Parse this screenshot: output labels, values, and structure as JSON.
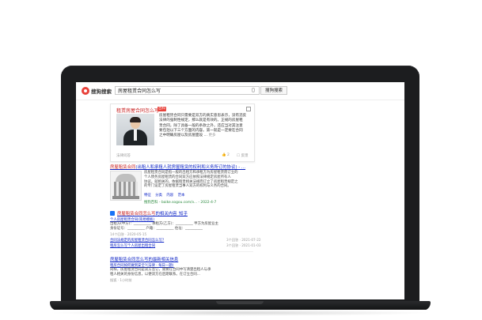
{
  "header": {
    "logo": "搜狗搜索",
    "query": "房屋租赁合同怎么写",
    "search_button": "搜狗搜索"
  },
  "answer_card": {
    "title": "租赁房屋合同怎么写",
    "badge": "百科",
    "lines": [
      "房屋租赁合同只需要是双方的真实意思表示，没有违反",
      "法律的强制性规定，那么就是有效的。正规的房屋租",
      "赁合同，除了具备一般的条款之外，还应当对其注意",
      "要包括以下三个方面的内容。第一就是一定要在合同",
      "之中明确房屋以及房屋面设 ... "
    ],
    "more": "更多",
    "source": "法律问答",
    "likes": "2",
    "feedback": "反馈"
  },
  "results": [
    {
      "title_pre": "房屋租赁合同",
      "title_rest": "(出租人和承租人就房屋租赁的权利和义务所订的协议) - ...",
      "lines": [
        "房屋租赁合同是指一般的出租方和承租方为房屋租赁而订立的",
        "个人债务房屋租赁的合同双方应依照法律规定房屋所有人",
        "协议。就相关的，依据租赁相关法规而订立了房屋租赁规定之",
        "的专门设定了房屋租赁当事人双方的权利与义务的合同。"
      ],
      "tags": [
        "特征",
        "分类",
        "内容",
        "范本"
      ],
      "url": "搜狗百科 - baike.sogou.com/v... - 2022-4-7"
    },
    {
      "title_pre": "房屋租赁合同怎么写",
      "title_rest": "的相关内容_知乎",
      "sub_title": "个人房屋租赁合同(简易模板)",
      "line1": "出租方(甲方)：__________ 承租方(乙方)：__________ 甲方为房屋业主",
      "line2": "身份证号：__________ 户籍：__________ 住址：__________",
      "meta1": "14个回答 · 2020-05-15",
      "link2": "合同法规定的房屋租赁合同怎么写?",
      "meta2": "3个回答 · 2021-07-22",
      "link3": "租房怎么写个人房屋出租合同",
      "meta3": "3个回答 · 2021-01-03"
    },
    {
      "title": "房屋租赁合同怎么写的最新相关信息",
      "news_title": "租房合同如何做到安全?(法律 - 每日一题)",
      "line1": "同样，房屋租赁合同是双方签订，需要在合同中写清楚出租人与承",
      "line2": "租人相关的身份信息，以便双方在后期联系。在订立合同...",
      "meta": "搜狐 · 1小时前"
    }
  ]
}
